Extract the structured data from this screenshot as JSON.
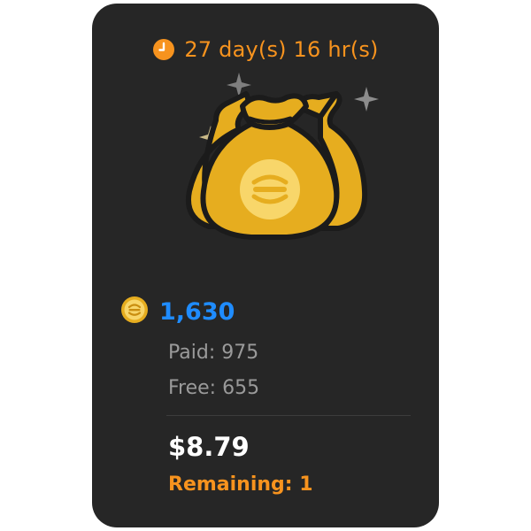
{
  "timer": {
    "icon": "clock-icon",
    "text": "27 day(s) 16 hr(s)"
  },
  "illustration": {
    "icon": "money-bags-icon"
  },
  "coins": {
    "icon": "coin-icon",
    "total": "1,630",
    "paid_label": "Paid: 975",
    "free_label": "Free: 655"
  },
  "offer": {
    "price": "$8.79",
    "remaining": "Remaining: 1"
  },
  "colors": {
    "card_background": "#262626",
    "accent_orange": "#f7931e",
    "total_blue": "#1f8cff",
    "muted_gray": "#9a9a9a",
    "bag_gold": "#e6ad1f"
  }
}
